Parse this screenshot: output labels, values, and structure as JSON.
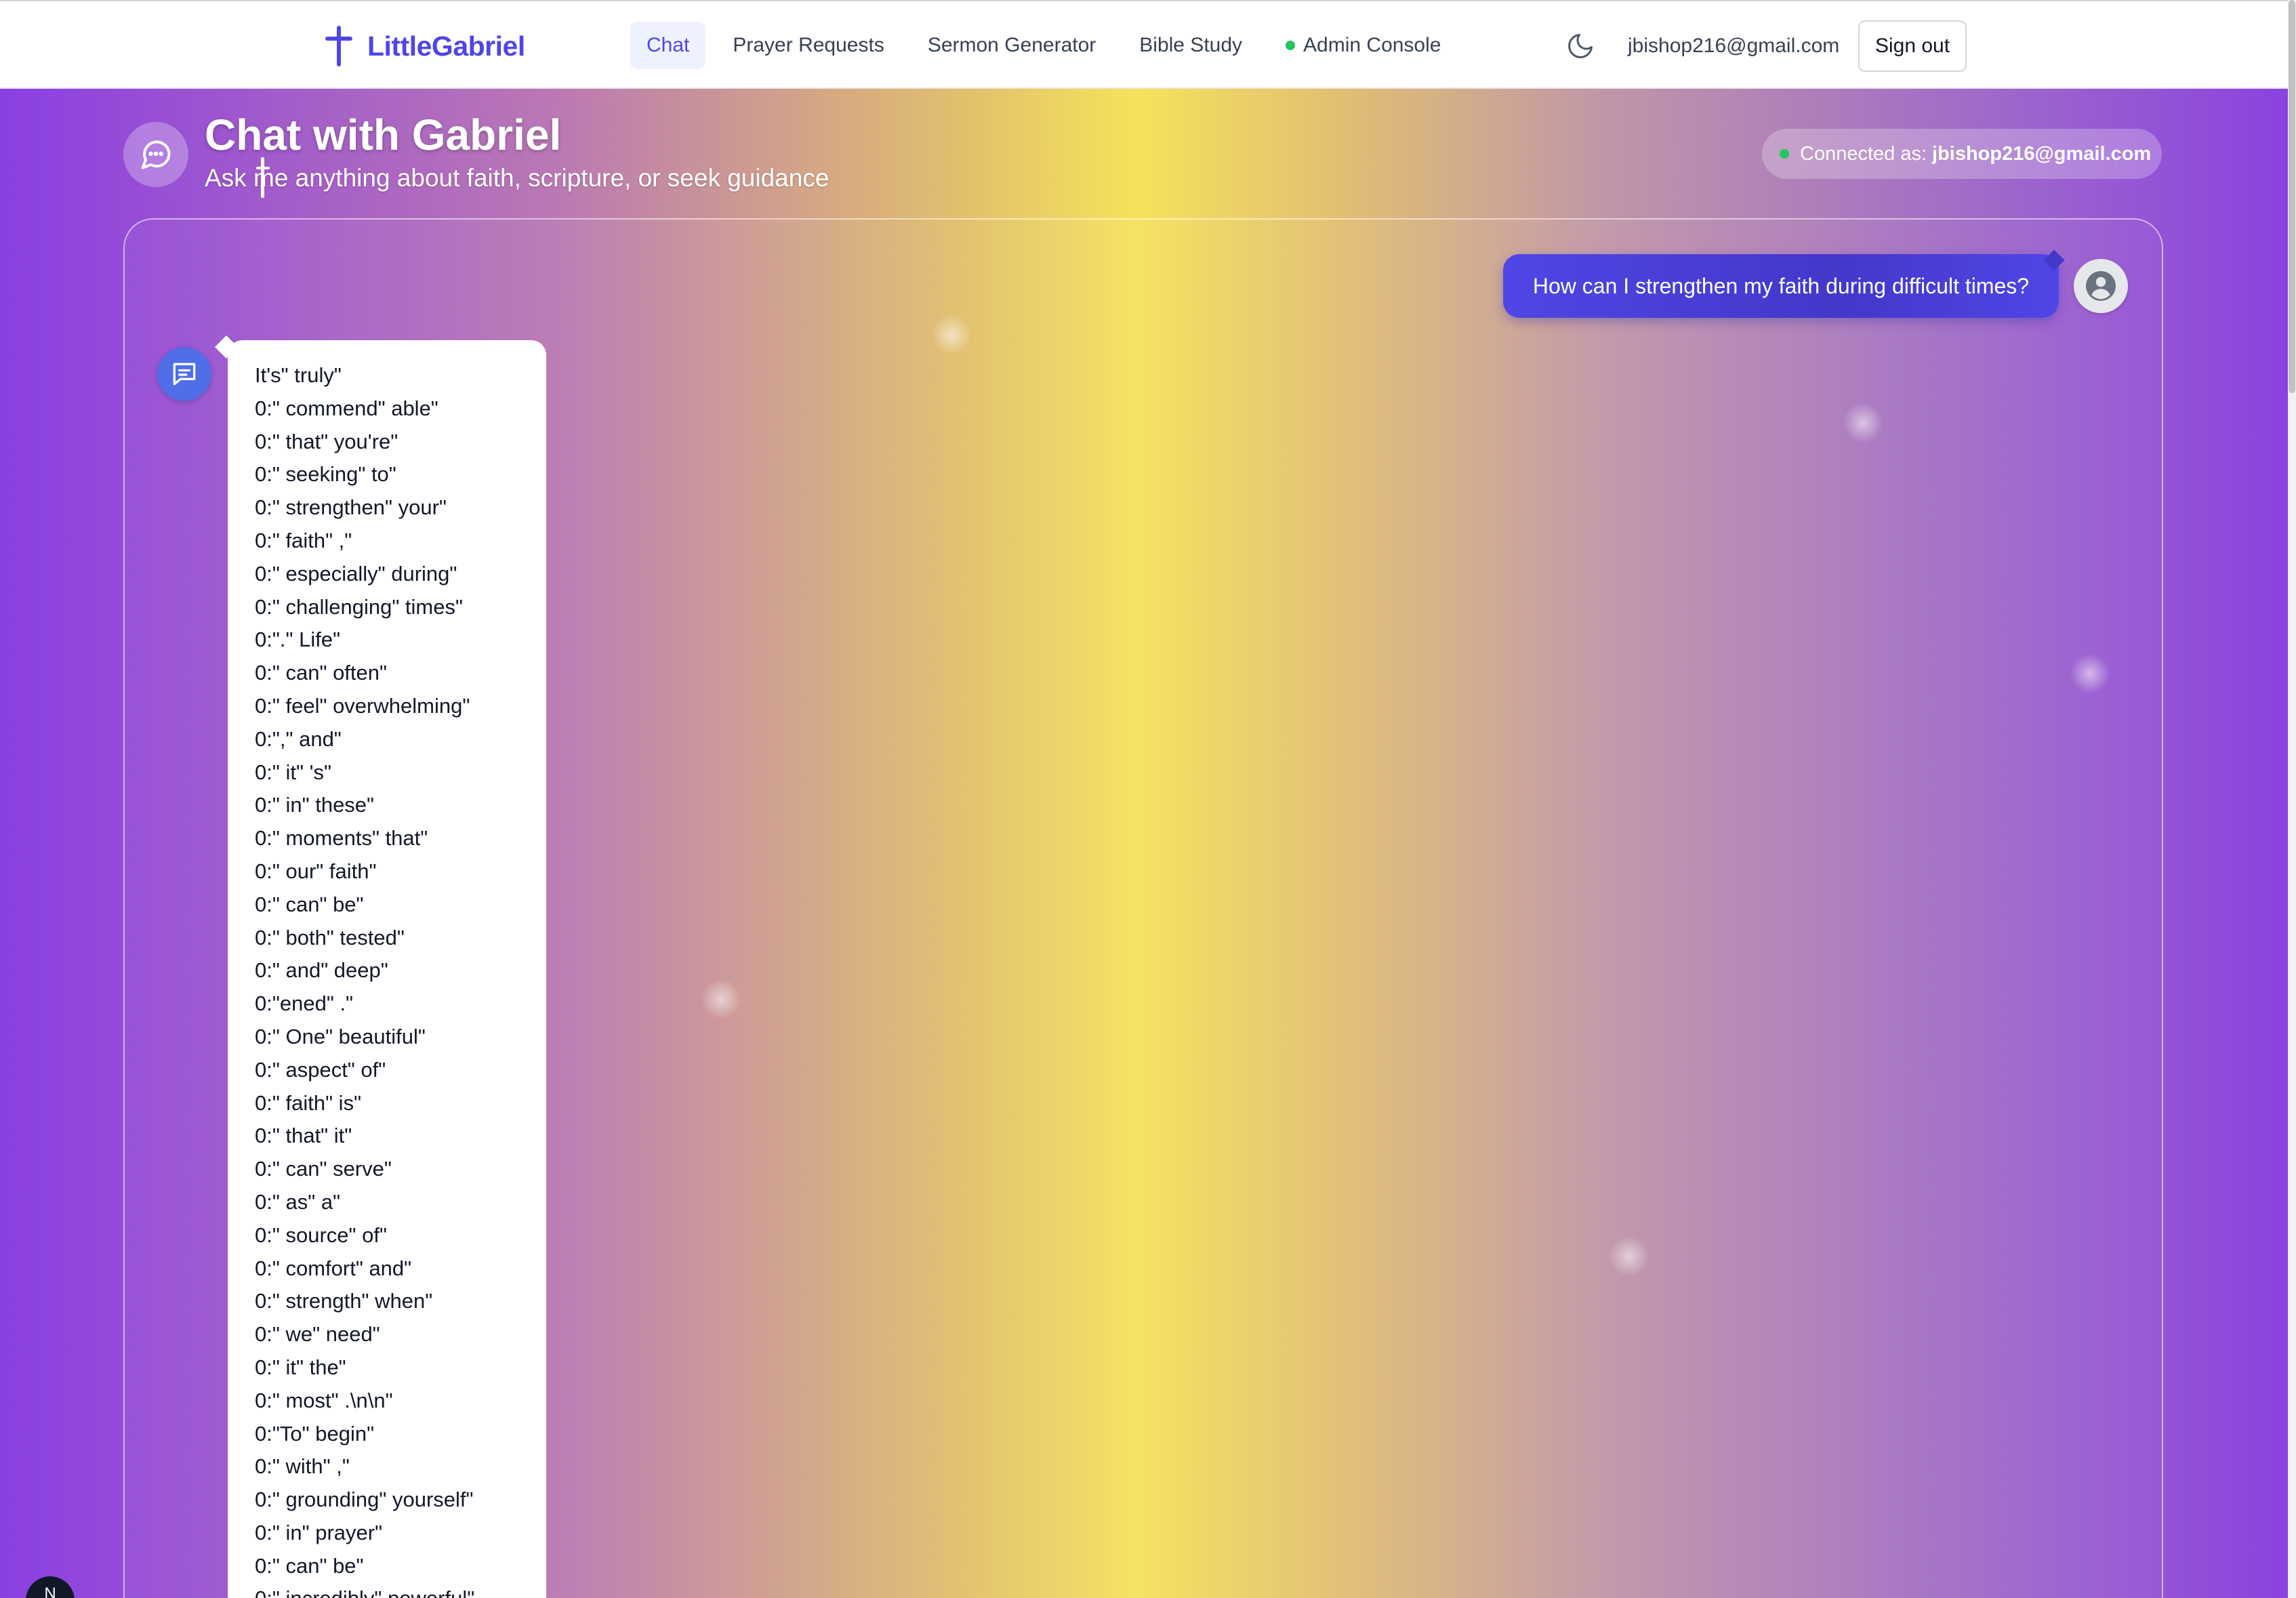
{
  "nav": {
    "brand": "LittleGabriel",
    "links": [
      {
        "label": "Chat"
      },
      {
        "label": "Prayer Requests"
      },
      {
        "label": "Sermon Generator"
      },
      {
        "label": "Bible Study"
      },
      {
        "label": "Admin Console"
      }
    ],
    "user_email": "jbishop216@gmail.com",
    "sign_out": "Sign out"
  },
  "header": {
    "title": "Chat with Gabriel",
    "subtitle": "Ask me anything about faith, scripture, or seek guidance",
    "connected_label": "Connected as:",
    "connected_email": "jbishop216@gmail.com"
  },
  "chat": {
    "user_message": "How can I strengthen my faith during difficult times?",
    "bot_lines": [
      "It's\" truly\"",
      "0:\" commend\" able\"",
      "0:\" that\" you're\"",
      "0:\" seeking\" to\"",
      "0:\" strengthen\" your\"",
      "0:\" faith\" ,\"",
      "0:\" especially\" during\"",
      "0:\" challenging\" times\"",
      "0:\".\" Life\"",
      "0:\" can\" often\"",
      "0:\" feel\" overwhelming\"",
      "0:\",\" and\"",
      "0:\" it\" 's\"",
      "0:\" in\" these\"",
      "0:\" moments\" that\"",
      "0:\" our\" faith\"",
      "0:\" can\" be\"",
      "0:\" both\" tested\"",
      "0:\" and\" deep\"",
      "0:\"ened\" .\"",
      "0:\" One\" beautiful\"",
      "0:\" aspect\" of\"",
      "0:\" faith\" is\"",
      "0:\" that\" it\"",
      "0:\" can\" serve\"",
      "0:\" as\" a\"",
      "0:\" source\" of\"",
      "0:\" comfort\" and\"",
      "0:\" strength\" when\"",
      "0:\" we\" need\"",
      "0:\" it\" the\"",
      "0:\" most\" .\\n\\n\"",
      "0:\"To\" begin\"",
      "0:\" with\" ,\"",
      "0:\" grounding\" yourself\"",
      "0:\" in\" prayer\"",
      "0:\" can\" be\"",
      "0:\" incredibly\" powerful\""
    ]
  },
  "colors": {
    "accent": "#4f46e5",
    "online": "#22c55e",
    "gradient_edge": "#8a3fe2",
    "gradient_center": "#f6e25c"
  },
  "icons": {
    "brand": "cross-icon",
    "theme": "moon-icon",
    "header": "chat-bubble-icon",
    "user": "user-avatar-icon",
    "bot": "message-square-icon"
  }
}
